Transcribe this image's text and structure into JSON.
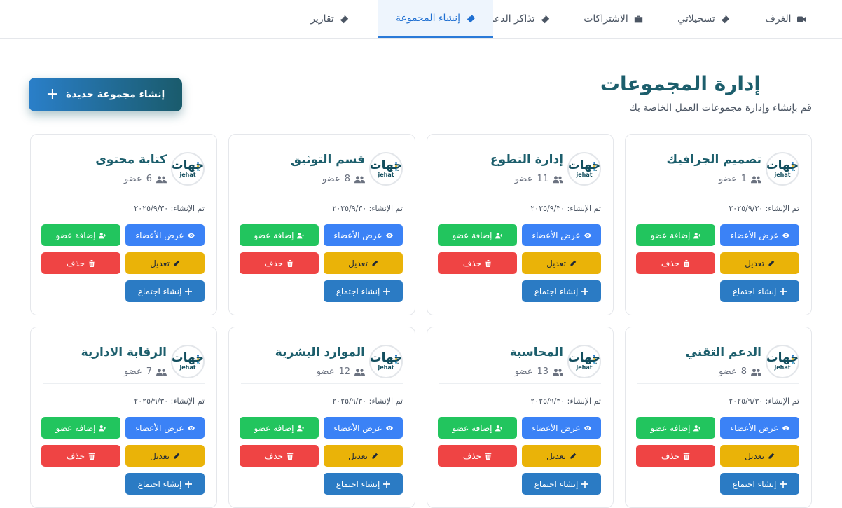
{
  "tabs": [
    {
      "label": "الغرف",
      "icon": "video-icon",
      "active": false,
      "right": 0,
      "width": 160
    },
    {
      "label": "تسجيلاتي",
      "icon": "ticket-icon",
      "active": false
    },
    {
      "label": "الاشتراكات",
      "icon": "briefcase-icon",
      "active": false
    },
    {
      "label": "تذاكر الدعم",
      "icon": "ticket-icon",
      "active": false
    },
    {
      "label": "إنشاء المجموعة",
      "icon": "ticket-icon",
      "active": true
    },
    {
      "label": "تقارير",
      "icon": "ticket-icon",
      "active": false
    }
  ],
  "header": {
    "title": "إدارة المجموعات",
    "subtitle": "قم بإنشاء وإدارة مجموعات العمل الخاصة بك",
    "create_button": "إنشاء مجموعة جديدة"
  },
  "logo": {
    "ar": "جهات",
    "en": "jehat"
  },
  "labels": {
    "created_prefix": "تم الإنشاء:",
    "members_suffix": "عضو",
    "view_members": "عرض الأعضاء",
    "add_member": "إضافة عضو",
    "edit": "تعديل",
    "delete": "حذف",
    "create_meeting": "إنشاء اجتماع"
  },
  "groups": [
    {
      "name": "تصميم الجرافيك",
      "members": "1",
      "created": "٢٠٢٥/٩/٣٠"
    },
    {
      "name": "إدارة التطوع",
      "members": "11",
      "created": "٢٠٢٥/٩/٣٠"
    },
    {
      "name": "قسم التوثيق",
      "members": "8",
      "created": "٢٠٢٥/٩/٣٠"
    },
    {
      "name": "كتابة محتوى",
      "members": "6",
      "created": "٢٠٢٥/٩/٣٠"
    },
    {
      "name": "الدعم التقني",
      "members": "8",
      "created": "٢٠٢٥/٩/٣٠"
    },
    {
      "name": "المحاسبة",
      "members": "13",
      "created": "٢٠٢٥/٩/٣٠"
    },
    {
      "name": "الموارد البشرية",
      "members": "12",
      "created": "٢٠٢٥/٩/٣٠"
    },
    {
      "name": "الرقابة الادارية",
      "members": "7",
      "created": "٢٠٢٥/٩/٣٠"
    }
  ],
  "colors": {
    "primary": "#3b82f6",
    "success": "#22c55e",
    "warning": "#eab308",
    "danger": "#ef4444",
    "meeting": "#2b7bc4",
    "title": "#1c5e6c",
    "active_tab": "#1f6fd1"
  }
}
